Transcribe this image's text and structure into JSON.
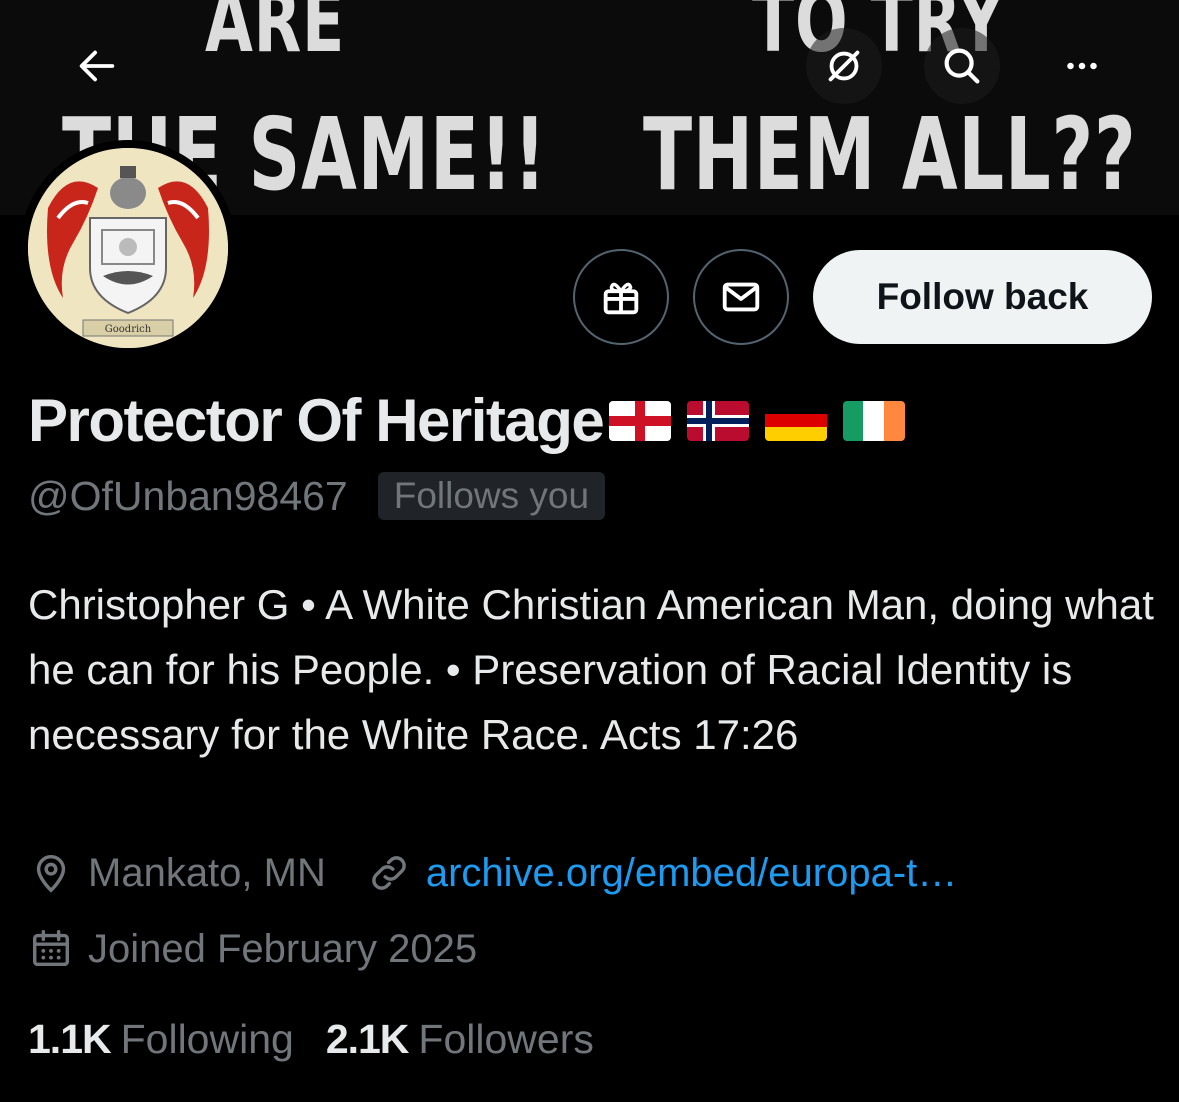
{
  "banner": {
    "line1_left": "ARE",
    "line1_right": "TO TRY",
    "line2_left": "THE SAME!!",
    "line2_right": "THEM ALL??"
  },
  "nav": {
    "back_icon": "arrow-left-icon",
    "sync_icon": "sync-off-icon",
    "search_icon": "search-icon",
    "more_icon": "more-horizontal-icon"
  },
  "avatar": {
    "crest_label": "Goodrich"
  },
  "actions": {
    "follow_label": "Follow back"
  },
  "profile": {
    "display_name": "Protector Of Heritage",
    "flags": [
      "england-flag",
      "norway-flag",
      "germany-flag",
      "ireland-flag"
    ],
    "handle": "@OfUnban98467",
    "follows_you": "Follows you",
    "bio": "Christopher G • A White Christian American Man, doing what he can for his People. • Preservation of Racial Identity is necessary for the White Race. Acts 17:26",
    "location": "Mankato, MN",
    "website": "archive.org/embed/europa-t…",
    "joined": "Joined February 2025"
  },
  "stats": {
    "following_count": "1.1K",
    "following_label": "Following",
    "followers_count": "2.1K",
    "followers_label": "Followers"
  },
  "colors": {
    "background": "#000000",
    "text_primary": "#e7e9ea",
    "text_secondary": "#71767b",
    "link": "#1d9bf0",
    "button_bg": "#eff3f4",
    "button_text": "#0f1419"
  }
}
